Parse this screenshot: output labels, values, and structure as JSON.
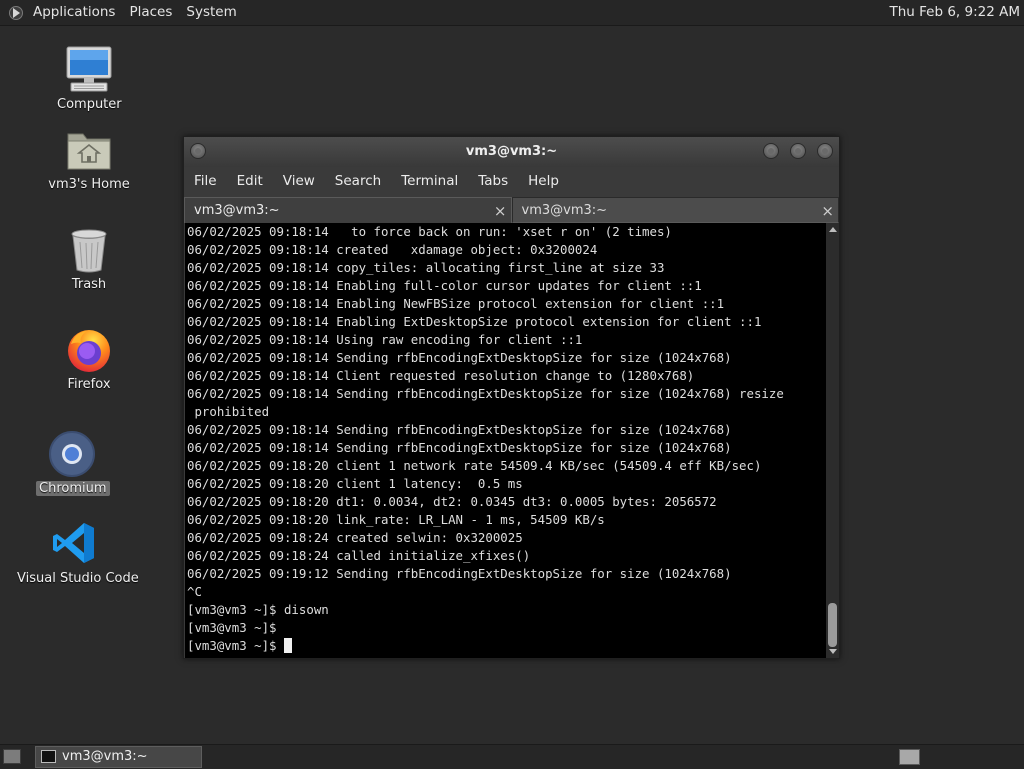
{
  "top_panel": {
    "menus": [
      "Applications",
      "Places",
      "System"
    ],
    "clock": "Thu Feb  6,  9:22 AM"
  },
  "desktop_icons": [
    {
      "label": "Computer",
      "icon": "computer-icon"
    },
    {
      "label": "vm3's Home",
      "icon": "home-folder-icon"
    },
    {
      "label": "Trash",
      "icon": "trash-icon"
    },
    {
      "label": "Firefox",
      "icon": "firefox-icon"
    },
    {
      "label": "Chromium",
      "icon": "chromium-icon",
      "selected": true
    },
    {
      "label": "Visual Studio Code",
      "icon": "vscode-icon"
    }
  ],
  "window": {
    "title": "vm3@vm3:~",
    "menu": [
      "File",
      "Edit",
      "View",
      "Search",
      "Terminal",
      "Tabs",
      "Help"
    ],
    "tabs": [
      {
        "label": "vm3@vm3:~",
        "active": true
      },
      {
        "label": "vm3@vm3:~",
        "active": false
      }
    ],
    "close_glyph": "×",
    "terminal_lines": [
      "06/02/2025 09:18:14   to force back on run: 'xset r on' (2 times)",
      "06/02/2025 09:18:14 created   xdamage object: 0x3200024",
      "06/02/2025 09:18:14 copy_tiles: allocating first_line at size 33",
      "06/02/2025 09:18:14 Enabling full-color cursor updates for client ::1",
      "06/02/2025 09:18:14 Enabling NewFBSize protocol extension for client ::1",
      "06/02/2025 09:18:14 Enabling ExtDesktopSize protocol extension for client ::1",
      "06/02/2025 09:18:14 Using raw encoding for client ::1",
      "06/02/2025 09:18:14 Sending rfbEncodingExtDesktopSize for size (1024x768)",
      "06/02/2025 09:18:14 Client requested resolution change to (1280x768)",
      "06/02/2025 09:18:14 Sending rfbEncodingExtDesktopSize for size (1024x768) resize",
      " prohibited",
      "06/02/2025 09:18:14 Sending rfbEncodingExtDesktopSize for size (1024x768)",
      "06/02/2025 09:18:14 Sending rfbEncodingExtDesktopSize for size (1024x768)",
      "06/02/2025 09:18:20 client 1 network rate 54509.4 KB/sec (54509.4 eff KB/sec)",
      "06/02/2025 09:18:20 client 1 latency:  0.5 ms",
      "06/02/2025 09:18:20 dt1: 0.0034, dt2: 0.0345 dt3: 0.0005 bytes: 2056572",
      "06/02/2025 09:18:20 link_rate: LR_LAN - 1 ms, 54509 KB/s",
      "06/02/2025 09:18:24 created selwin: 0x3200025",
      "06/02/2025 09:18:24 called initialize_xfixes()",
      "06/02/2025 09:19:12 Sending rfbEncodingExtDesktopSize for size (1024x768)",
      "^C",
      "[vm3@vm3 ~]$ disown",
      "[vm3@vm3 ~]$"
    ],
    "prompt": "[vm3@vm3 ~]$ "
  },
  "taskbar": {
    "task_label": "vm3@vm3:~"
  }
}
